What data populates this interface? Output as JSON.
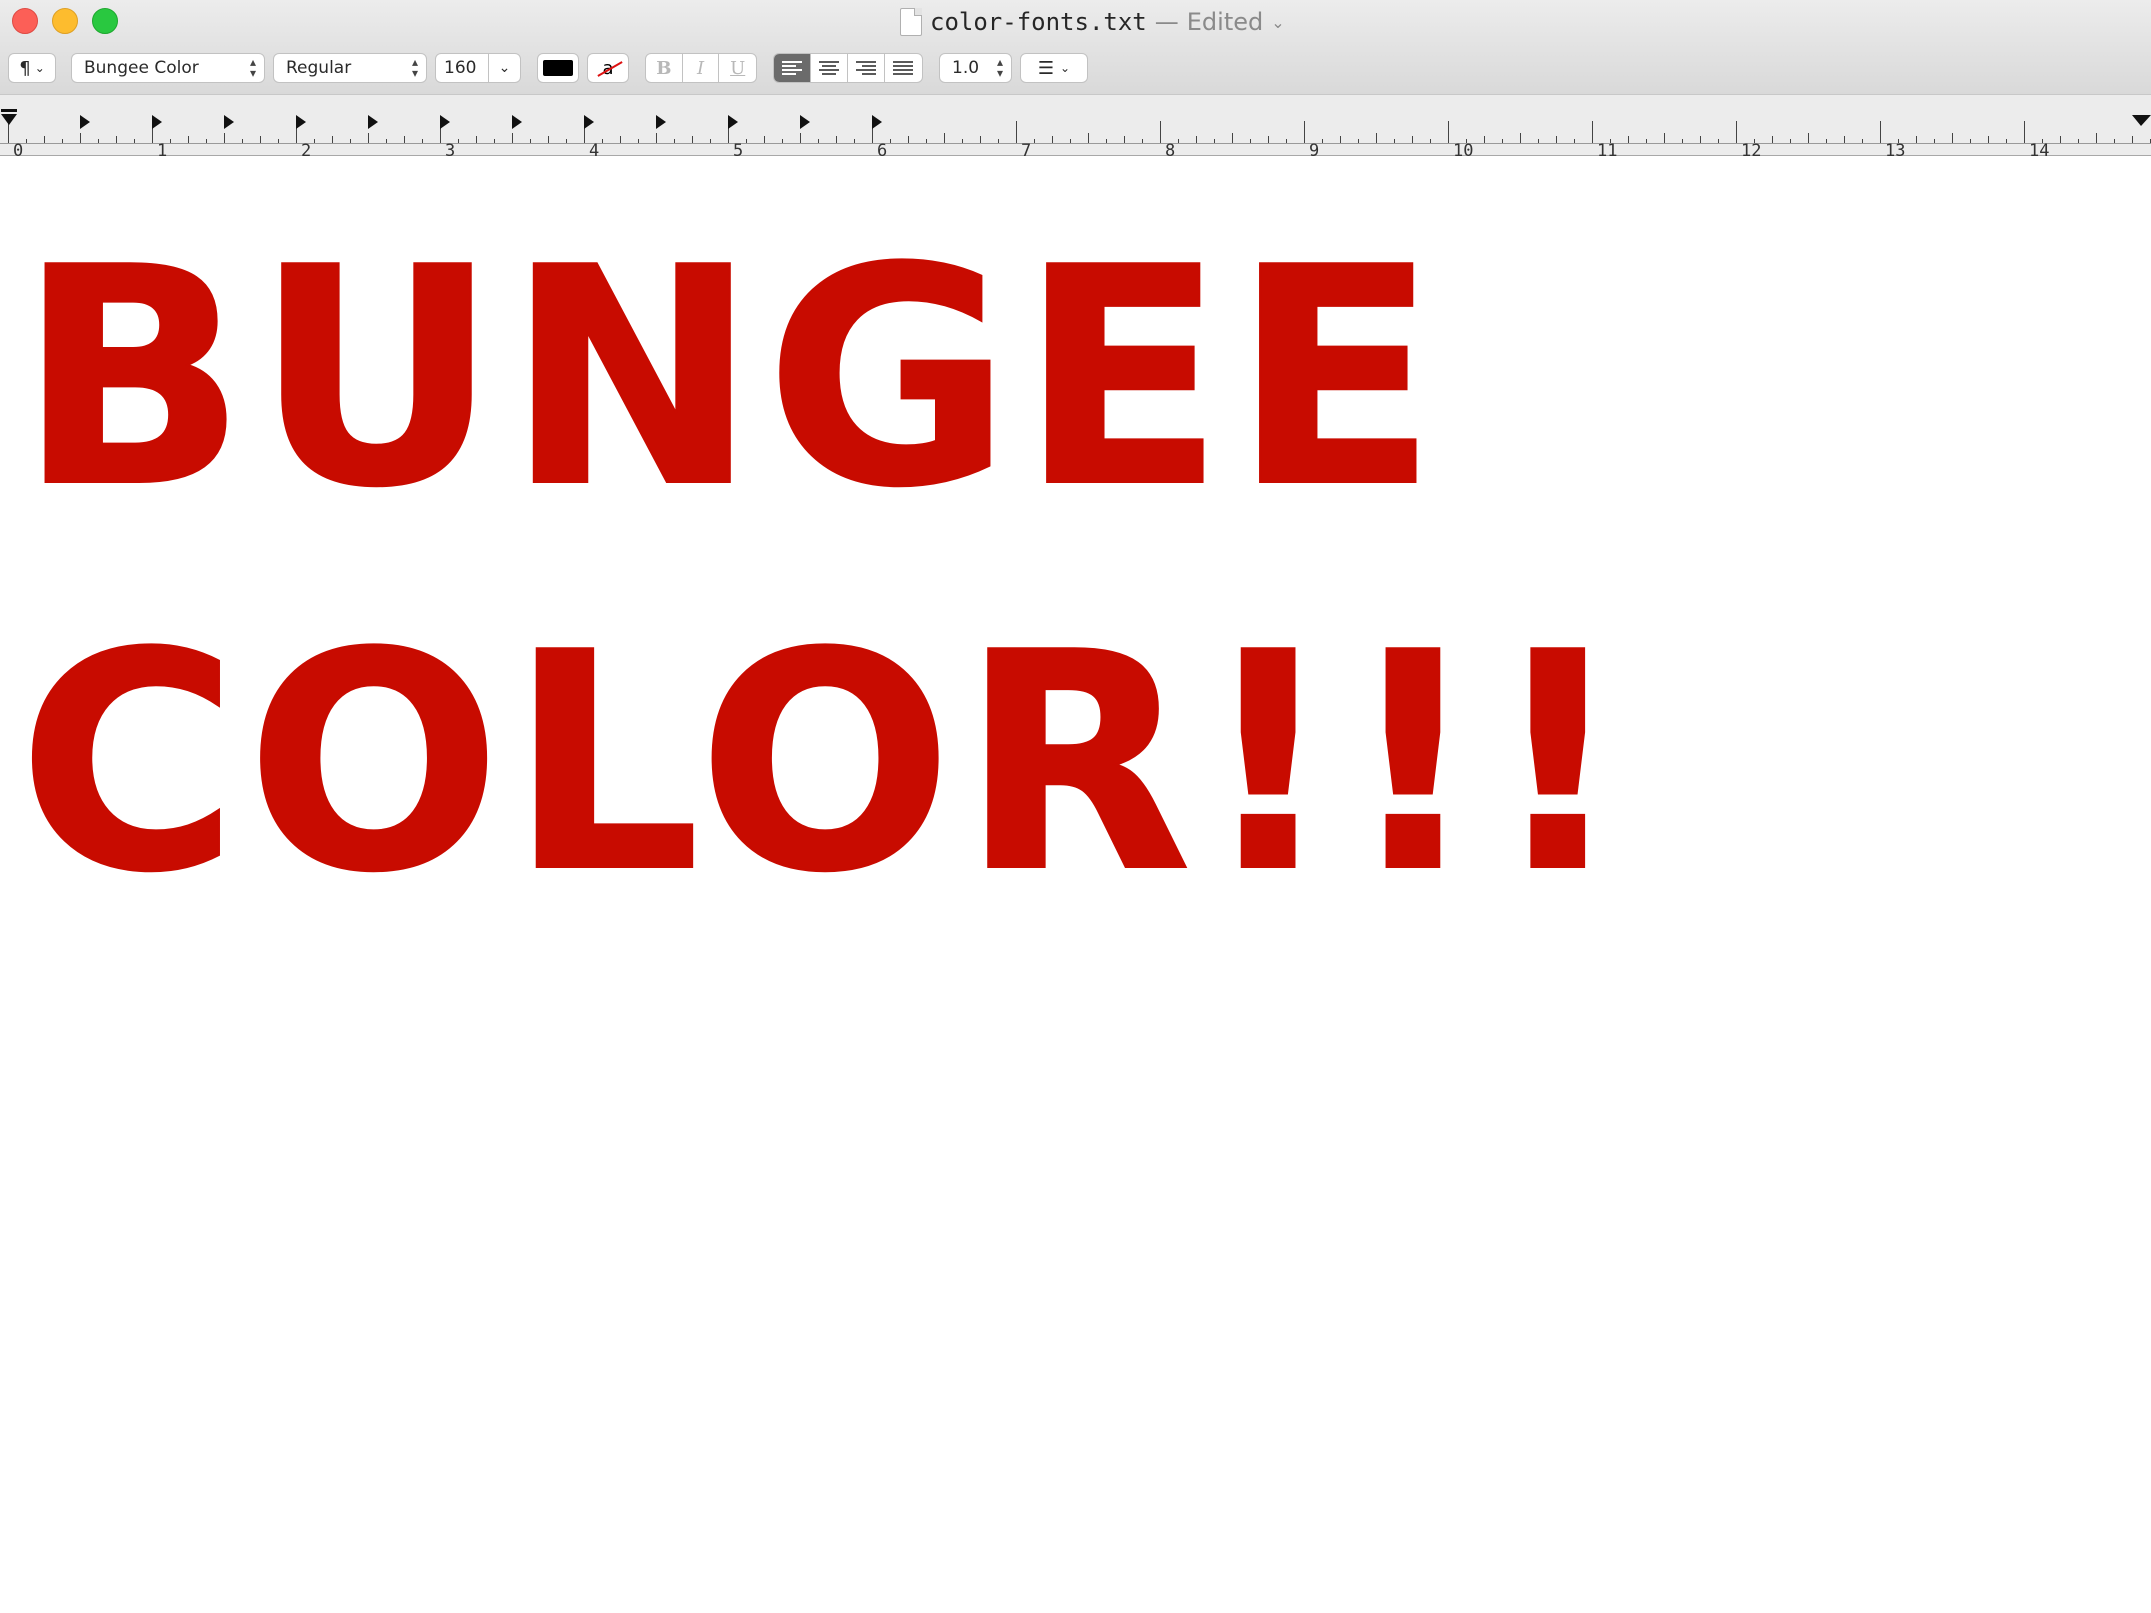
{
  "window": {
    "filename": "color-fonts.txt",
    "separator": "—",
    "status": "Edited",
    "status_chevron": "chevron-down-icon",
    "traffic_lights": {
      "close": "#fc5f57",
      "minimize": "#fdbc2e",
      "maximize": "#29c840"
    }
  },
  "toolbar": {
    "paragraph_styles_icon": "¶",
    "font_family": "Bungee Color",
    "font_style": "Regular",
    "font_size": "160",
    "text_color": "#000000",
    "background_color_glyph": "a",
    "bold": "B",
    "italic": "I",
    "underline": "U",
    "alignment_active": "left",
    "line_spacing": "1.0",
    "list_icon": "list-bullets-icon"
  },
  "ruler": {
    "labels": [
      "0",
      "1",
      "2",
      "3",
      "4",
      "5",
      "6",
      "7",
      "8",
      "9",
      "10",
      "11",
      "12",
      "13",
      "14"
    ]
  },
  "document": {
    "text_color": "#c80b00",
    "lines": [
      "BUNGEE",
      "COLOR!!!"
    ]
  }
}
